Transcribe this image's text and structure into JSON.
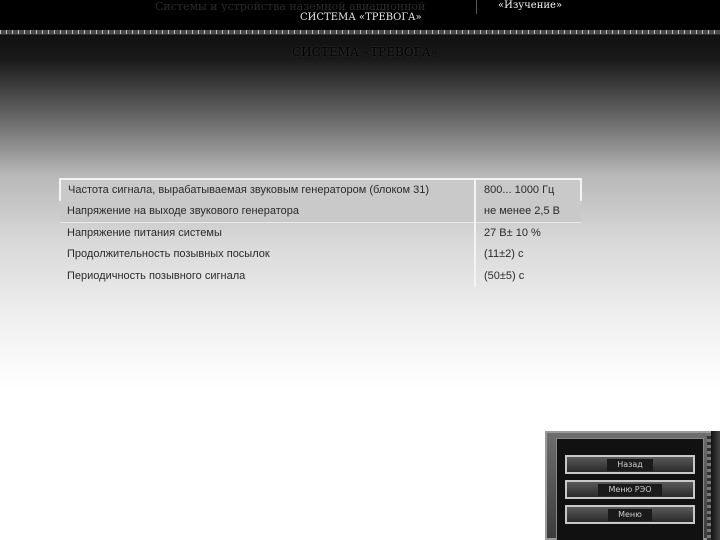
{
  "header": {
    "faded_title": "Системы и устройства наземной авиационной",
    "subtitle": "СИСТЕМА «ТРЕВОГА»",
    "mode": "«Изучение»"
  },
  "page": {
    "title": "СИСТЕМА «ТРЕВОГА»"
  },
  "specs": [
    {
      "parameter": "Частота сигнала, вырабатываемая звуковым генератором (блоком 31)",
      "value": "800... 1000 Гц"
    },
    {
      "parameter": "Напряжение на выходе звукового генератора",
      "value": "не менее 2,5 В"
    },
    {
      "parameter": "Напряжение питания системы",
      "value": "27 В± 10 %"
    },
    {
      "parameter": "Продолжительность позывных посылок",
      "value": "(11±2) с"
    },
    {
      "parameter": "Периодичность позывного сигнала",
      "value": "(50±5) с"
    }
  ],
  "nav": {
    "buttons": [
      "Назад",
      "Меню РЭО",
      "Меню"
    ]
  }
}
